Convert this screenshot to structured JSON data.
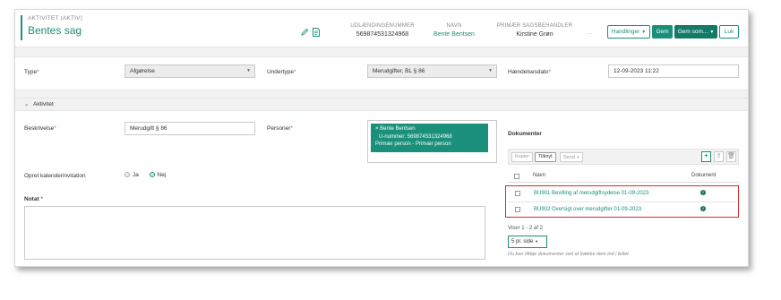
{
  "header": {
    "activity_label": "AKTIVITET (AKTIV)",
    "title": "Bentes sag",
    "edit_icon": "pencil-icon",
    "doc_icon": "document-icon",
    "meta": [
      {
        "label": "UDLÆNDINGENUMMER",
        "value": "569874531324968"
      },
      {
        "label": "NAVN",
        "value": "Bente Bentsen"
      },
      {
        "label": "PRIMÆR SAGSBEHANDLER",
        "value": "Kirstine Grøn"
      }
    ],
    "more": "···",
    "buttons": {
      "handlinger": "Handlinger",
      "gem": "Gem",
      "gem_som": "Gem som...",
      "luk": "Luk"
    }
  },
  "form": {
    "type_label": "Type",
    "type_value": "Afgørelse",
    "undertype_label": "Undertype",
    "undertype_value": "Merudgifter, BL § 86",
    "haendelsesdato_label": "Hændelsesdato",
    "haendelsesdato_value": "12-09-2023 11:22",
    "required_mark": "*"
  },
  "aktivitet": {
    "section_title": "Aktivitet",
    "beskrivelse_label": "Beskrivelse",
    "beskrivelse_value": "Merudgift § 86",
    "personer_label": "Personer",
    "person": {
      "name": "× Bente Bentsen",
      "unummer": "U-nummer: 569874531324968",
      "role": "Primær person - Primær person"
    },
    "kalender_label": "Opret kalenderinvitation",
    "ja": "Ja",
    "nej": "Nej",
    "notat_label": "Notat"
  },
  "documents": {
    "title": "Dokumenter",
    "toolbar": {
      "kopier": "Kopier",
      "tilknyt": "Tilknyt",
      "send": "Send"
    },
    "col_navn": "Navn",
    "col_dokument": "Dokument",
    "rows": [
      {
        "name": "BU901 Bevilling af merudgiftsydelse 01-09-2023"
      },
      {
        "name": "BU902 Oversigt over merudgifter 01-09-2023"
      }
    ],
    "viser": "Viser 1 - 2 af 2",
    "per_page": "5 pr. side",
    "hint": "Du kan tilføje dokumenter ved at trække dem ind i feltet."
  },
  "colors": {
    "accent": "#1a8f7a",
    "highlight": "#d52b2b"
  }
}
